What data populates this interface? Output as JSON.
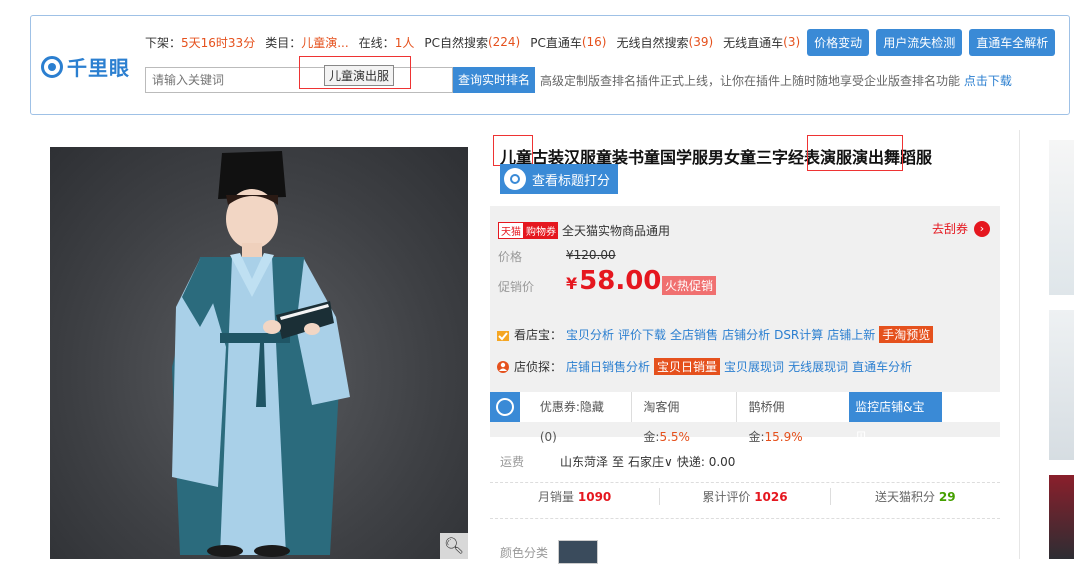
{
  "plugin": {
    "logo_text": "千里眼",
    "row1": [
      {
        "label": "下架：",
        "value": "5天16时33分"
      },
      {
        "label": "类目：",
        "value": "儿童演..."
      },
      {
        "label": "在线：",
        "value": "1人"
      },
      {
        "label": "PC自然搜索",
        "value": "(224)"
      },
      {
        "label": "PC直通车",
        "value": "(16)"
      },
      {
        "label": "无线自然搜索",
        "value": "(39)"
      },
      {
        "label": "无线直通车",
        "value": "(3)"
      }
    ],
    "buttons": [
      "价格变动",
      "用户流失检测",
      "直通车全解析"
    ],
    "search_placeholder": "请输入关键词",
    "search_button": "查询实时排名",
    "tooltip_tag": "儿童演出服",
    "notice": "高级定制版查排名插件正式上线，让你在插件上随时随地享受企业版查排名功能",
    "notice_link": "点击下载"
  },
  "product": {
    "title": "儿童古装汉服童装书童国学服男女童三字经表演服演出舞蹈服",
    "score_button": "查看标题打分",
    "tmall_badge": "天猫",
    "coupon_badge": "购物券",
    "coupon_text": "全天猫实物商品通用",
    "grab_coupon": "去刮券",
    "price_label": "价格",
    "original_price": "¥120.00",
    "promo_label": "促销价",
    "currency": "¥",
    "promo_price": "58.00",
    "hot_tag": "火热促销",
    "shop_tools": {
      "head": "看店宝：",
      "links": [
        "宝贝分析",
        "评价下载",
        "全店销售",
        "店铺分析",
        "DSR计算",
        "店铺上新"
      ],
      "highlight": "手淘预览"
    },
    "detective": {
      "head": "店侦探：",
      "links_before": [
        "店铺日销售分析"
      ],
      "highlight": "宝贝日销量",
      "links_after": [
        "宝贝展现词",
        "无线展现词",
        "直通车分析"
      ]
    },
    "monitor": {
      "coupon_label": "优惠券:",
      "coupon_value": "隐藏(0)",
      "taoke_label": "淘客佣金:",
      "taoke_value": "5.5%",
      "queqiao_label": "鹊桥佣金:",
      "queqiao_value": "15.9%",
      "watch_button": "监控店铺&宝贝"
    },
    "shipping_label": "运费",
    "shipping_from": "山东菏泽",
    "shipping_to_word": "至",
    "shipping_to": "石家庄",
    "shipping_fee": "快递: 0.00",
    "stats": [
      {
        "label": "月销量",
        "value": "1090"
      },
      {
        "label": "累计评价",
        "value": "1026"
      },
      {
        "label": "送天猫积分",
        "value": "29"
      }
    ],
    "color_label": "颜色分类"
  },
  "colors": {
    "accent_blue": "#3a8ad6",
    "price_red": "#e5171f",
    "highlight_orange": "#e5511d"
  }
}
